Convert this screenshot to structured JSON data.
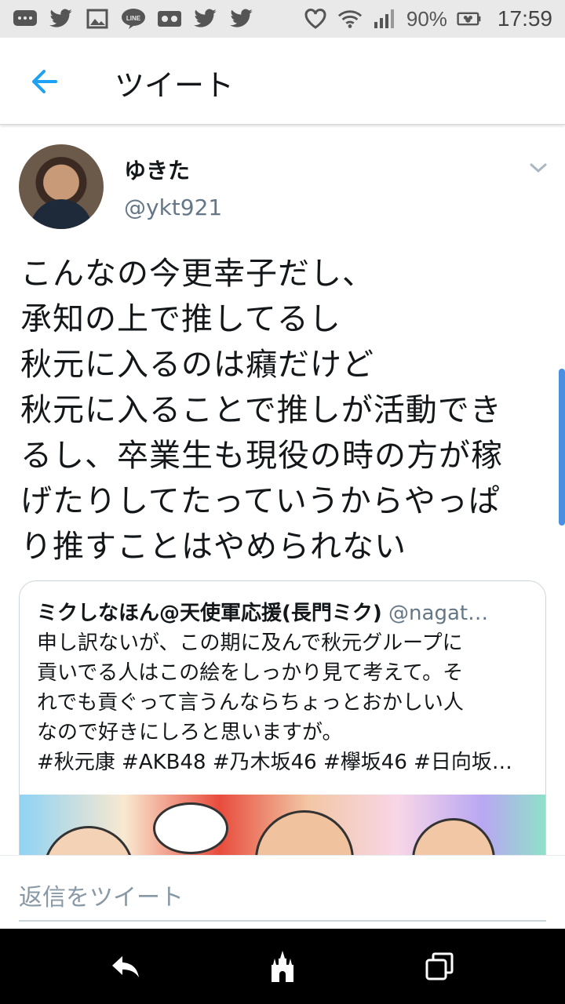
{
  "status_bar": {
    "battery": "90%",
    "time": "17:59",
    "icons": [
      "message-icon",
      "twitter-icon",
      "image-icon",
      "line-icon",
      "voicemail-icon",
      "twitter-icon",
      "twitter-icon",
      "heart-icon",
      "wifi-icon",
      "signal-icon",
      "battery-icon"
    ]
  },
  "header": {
    "title": "ツイート",
    "back_icon": "back-arrow-icon"
  },
  "tweet": {
    "author_name": "ゆきた",
    "author_handle": "@ykt921",
    "lines": [
      "こんなの今更幸子だし、",
      "承知の上で推してるし",
      "秋元に入るのは癪だけど",
      "秋元に入ることで推しが活動でき",
      "るし、卒業生も現役の時の方が稼",
      "げたりしてたっていうからやっぱ",
      "り推すことはやめられない"
    ]
  },
  "quote": {
    "name": "ミクしなほん@天使軍応援(長門ミク)",
    "handle": "@nagat…",
    "lines": [
      "申し訳ないが、この期に及んで秋元グループに",
      "貢いでる人はこの絵をしっかり見て考えて。そ",
      "れでも貢ぐって言うんならちょっとおかしい人",
      "なので好きにしろと思いますが。",
      "#秋元康 #AKB48 #乃木坂46 #欅坂46 #日向坂…"
    ]
  },
  "reply": {
    "placeholder": "返信をツイート"
  },
  "colors": {
    "accent": "#1da1f2",
    "text": "#14171a",
    "muted": "#657786"
  }
}
